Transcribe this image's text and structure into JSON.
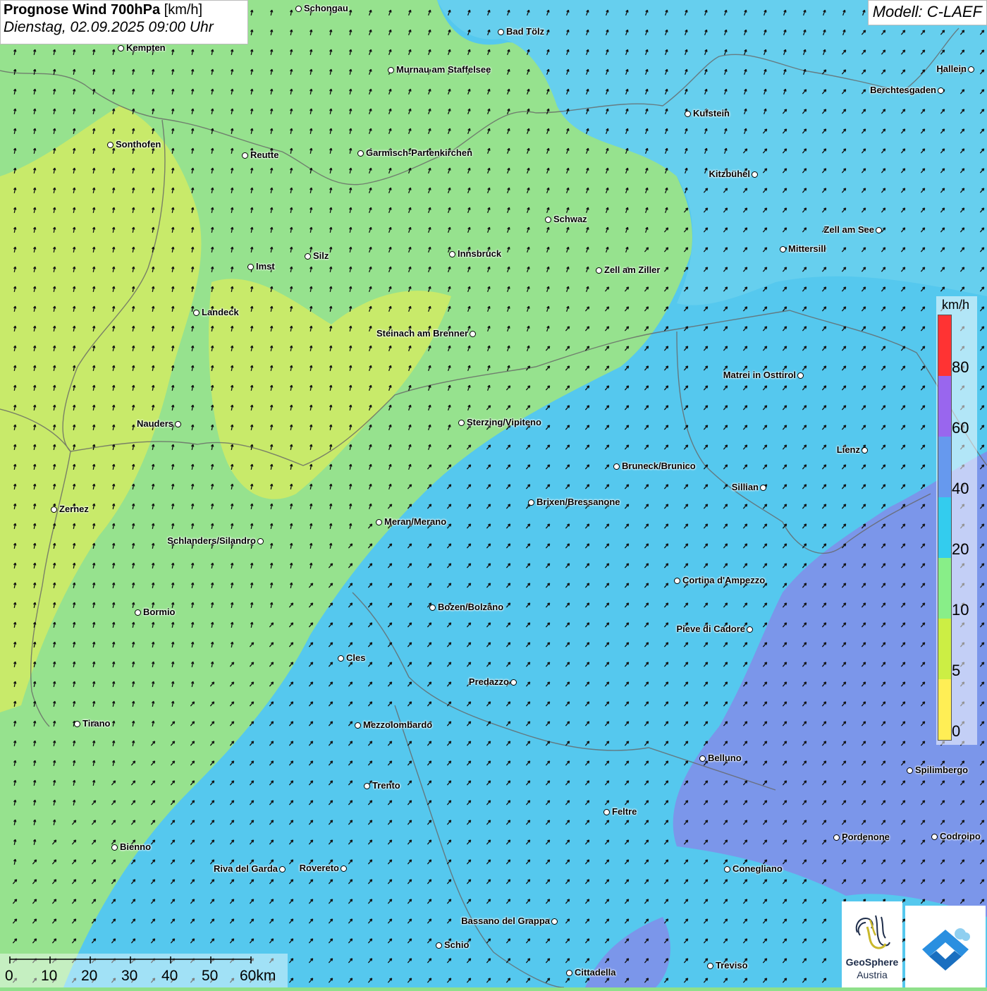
{
  "title": {
    "main": "Prognose Wind 700hPa",
    "unit": "[km/h]",
    "datetime": "Dienstag, 02.09.2025 09:00 Uhr"
  },
  "model": "Modell: C-LAEF",
  "legend": {
    "unit": "km/h",
    "classes": [
      {
        "label": "80",
        "color": "#ff3333"
      },
      {
        "label": "60",
        "color": "#9966ee"
      },
      {
        "label": "40",
        "color": "#6699ee"
      },
      {
        "label": "20",
        "color": "#33ccee"
      },
      {
        "label": "10",
        "color": "#88ee88"
      },
      {
        "label": "5",
        "color": "#ccee44"
      },
      {
        "label": "0",
        "color": "#ffee55"
      }
    ]
  },
  "scale": {
    "labels": [
      "0",
      "10",
      "20",
      "30",
      "40",
      "50",
      "60km"
    ]
  },
  "logos": {
    "geosphere_line1": "GeoSphere",
    "geosphere_line2": "Austria"
  },
  "wind": {
    "west_direction": "from south-southwest (toward NNE)",
    "east_direction": "from southwest (toward NE)"
  },
  "cities": [
    {
      "name": "Schongau"
    },
    {
      "name": "Bad Tölz"
    },
    {
      "name": "Kempten"
    },
    {
      "name": "Murnau am Staffelsee"
    },
    {
      "name": "Hallein"
    },
    {
      "name": "Berchtesgaden"
    },
    {
      "name": "Kufstein"
    },
    {
      "name": "Sonthofen"
    },
    {
      "name": "Reutte"
    },
    {
      "name": "Garmisch-Partenkirchen"
    },
    {
      "name": "Kitzbühel"
    },
    {
      "name": "Schwaz"
    },
    {
      "name": "Zell am See"
    },
    {
      "name": "Mittersill"
    },
    {
      "name": "Imst"
    },
    {
      "name": "Silz"
    },
    {
      "name": "Innsbruck"
    },
    {
      "name": "Zell am Ziller"
    },
    {
      "name": "Landeck"
    },
    {
      "name": "Steinach am Brenner"
    },
    {
      "name": "Matrei in Osttirol"
    },
    {
      "name": "Nauders"
    },
    {
      "name": "Sterzing/Vipiteno"
    },
    {
      "name": "Lienz"
    },
    {
      "name": "Bruneck/Brunico"
    },
    {
      "name": "Sillian"
    },
    {
      "name": "Zernez"
    },
    {
      "name": "Brixen/Bressanone"
    },
    {
      "name": "Meran/Merano"
    },
    {
      "name": "Schlanders/Silandro"
    },
    {
      "name": "Cortina d'Ampezzo"
    },
    {
      "name": "Bozen/Bolzano"
    },
    {
      "name": "Bormio"
    },
    {
      "name": "Pieve di Cadore"
    },
    {
      "name": "Cles"
    },
    {
      "name": "Predazzo"
    },
    {
      "name": "Tirano"
    },
    {
      "name": "Mezzolombardo"
    },
    {
      "name": "Belluno"
    },
    {
      "name": "Spilimbergo"
    },
    {
      "name": "Trento"
    },
    {
      "name": "Feltre"
    },
    {
      "name": "Pordenone"
    },
    {
      "name": "Codroipo"
    },
    {
      "name": "Bienno"
    },
    {
      "name": "Riva del Garda"
    },
    {
      "name": "Rovereto"
    },
    {
      "name": "Conegliano"
    },
    {
      "name": "Bassano del Grappa"
    },
    {
      "name": "Schio"
    },
    {
      "name": "Treviso"
    },
    {
      "name": "Cittadella"
    }
  ]
}
